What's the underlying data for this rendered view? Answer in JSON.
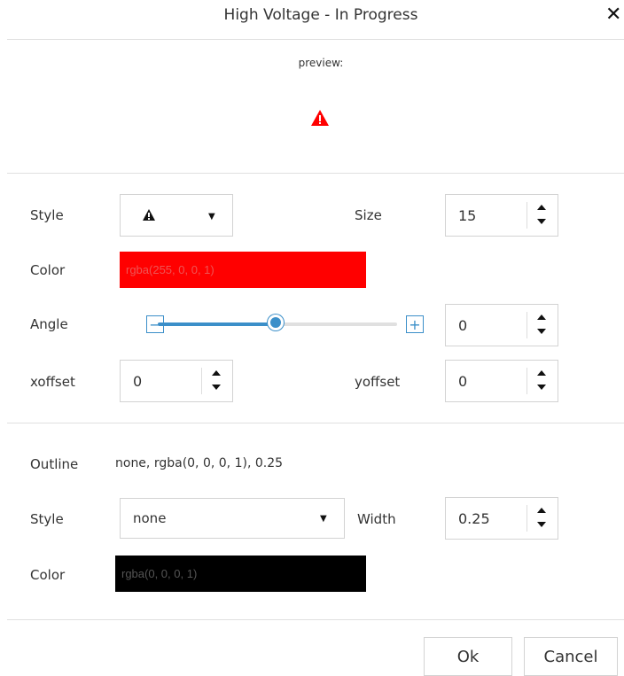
{
  "dialog": {
    "title": "High Voltage - In Progress",
    "close_icon": "close-icon"
  },
  "preview": {
    "label": "preview:",
    "symbol_icon": "warning-triangle-icon",
    "symbol_color": "#ff0000"
  },
  "marker": {
    "style_label": "Style",
    "style_value_icon": "warning-triangle-icon",
    "size_label": "Size",
    "size_value": "15",
    "color_label": "Color",
    "color_value": "rgba(255, 0, 0, 1)",
    "color_hex": "#ff0000",
    "angle_label": "Angle",
    "angle_value": "0",
    "angle_slider_fraction": 0.5,
    "xoffset_label": "xoffset",
    "xoffset_value": "0",
    "yoffset_label": "yoffset",
    "yoffset_value": "0"
  },
  "outline": {
    "label": "Outline",
    "summary": "none, rgba(0, 0, 0, 1), 0.25",
    "style_label": "Style",
    "style_value": "none",
    "width_label": "Width",
    "width_value": "0.25",
    "color_label": "Color",
    "color_value": "rgba(0, 0, 0, 1)",
    "color_hex": "#000000"
  },
  "footer": {
    "ok_label": "Ok",
    "cancel_label": "Cancel"
  },
  "accent_color": "#3b8fc9"
}
